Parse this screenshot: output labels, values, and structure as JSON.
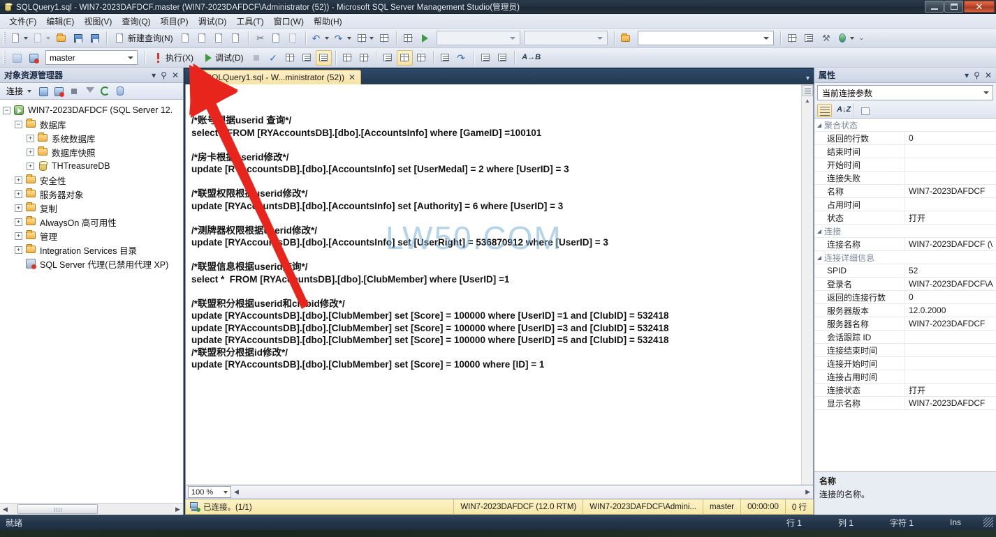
{
  "window": {
    "title": "SQLQuery1.sql - WIN7-2023DAFDCF.master (WIN7-2023DAFDCF\\Administrator (52)) - Microsoft SQL Server Management Studio(管理员)",
    "minimize_label": "最小化",
    "maximize_label": "最大化",
    "close_label": "✕"
  },
  "menubar": {
    "items": [
      {
        "label": "文件(F)"
      },
      {
        "label": "编辑(E)"
      },
      {
        "label": "视图(V)"
      },
      {
        "label": "查询(Q)"
      },
      {
        "label": "项目(P)"
      },
      {
        "label": "调试(D)"
      },
      {
        "label": "工具(T)"
      },
      {
        "label": "窗口(W)"
      },
      {
        "label": "帮助(H)"
      }
    ]
  },
  "toolbar_main": {
    "new_query_label": "新建查询(N)",
    "search_value": "",
    "filter_value": ""
  },
  "toolbar_sql": {
    "database_value": "master",
    "execute_label": "执行(X)",
    "debug_label": "调试(D)"
  },
  "object_explorer": {
    "title": "对象资源管理器",
    "connect_label": "连接",
    "tree": [
      {
        "label": "WIN7-2023DAFDCF (SQL Server 12.",
        "icon": "server-icon",
        "expander": "−",
        "indent": 0
      },
      {
        "label": "数据库",
        "icon": "folder-icon",
        "expander": "−",
        "indent": 1
      },
      {
        "label": "系统数据库",
        "icon": "folder-icon",
        "expander": "+",
        "indent": 2
      },
      {
        "label": "数据库快照",
        "icon": "folder-icon",
        "expander": "+",
        "indent": 2
      },
      {
        "label": "THTreasureDB",
        "icon": "database-icon",
        "expander": "+",
        "indent": 2
      },
      {
        "label": "安全性",
        "icon": "folder-icon",
        "expander": "+",
        "indent": 1
      },
      {
        "label": "服务器对象",
        "icon": "folder-icon",
        "expander": "+",
        "indent": 1
      },
      {
        "label": "复制",
        "icon": "folder-icon",
        "expander": "+",
        "indent": 1
      },
      {
        "label": "AlwaysOn 高可用性",
        "icon": "folder-icon",
        "expander": "+",
        "indent": 1
      },
      {
        "label": "管理",
        "icon": "folder-icon",
        "expander": "+",
        "indent": 1
      },
      {
        "label": "Integration Services 目录",
        "icon": "folder-icon",
        "expander": "+",
        "indent": 1
      },
      {
        "label": "SQL Server 代理(已禁用代理 XP)",
        "icon": "agent-icon",
        "expander": "",
        "indent": 1
      }
    ]
  },
  "editor": {
    "tab_label": "SQLQuery1.sql - W...ministrator (52))",
    "tab_close": "✕",
    "watermark": "LW50.COM",
    "zoom_value": "100 %",
    "lines": [
      "/*账号根据userid 查询*/",
      "select * FROM [RYAccountsDB].[dbo].[AccountsInfo] where [GameID] =100101",
      "",
      "/*房卡根据userid修改*/",
      "update [RYAccountsDB].[dbo].[AccountsInfo] set [UserMedal] = 2 where [UserID] = 3",
      "",
      "/*联盟权限根据userid修改*/",
      "update [RYAccountsDB].[dbo].[AccountsInfo] set [Authority] = 6 where [UserID] = 3",
      "",
      "/*测牌器权限根据userid修改*/",
      "update [RYAccountsDB].[dbo].[AccountsInfo] set [UserRight] = 536870912 where [UserID] = 3",
      "",
      "/*联盟信息根据userid查询*/",
      "select *  FROM [RYAccountsDB].[dbo].[ClubMember] where [UserID] =1",
      "",
      "/*联盟积分根据userid和clubid修改*/",
      "update [RYAccountsDB].[dbo].[ClubMember] set [Score] = 100000 where [UserID] =1 and [ClubID] = 532418",
      "update [RYAccountsDB].[dbo].[ClubMember] set [Score] = 100000 where [UserID] =3 and [ClubID] = 532418",
      "update [RYAccountsDB].[dbo].[ClubMember] set [Score] = 100000 where [UserID] =5 and [ClubID] = 532418",
      "/*联盟积分根据id修改*/",
      "update [RYAccountsDB].[dbo].[ClubMember] set [Score] = 10000 where [ID] = 1"
    ]
  },
  "doc_status": {
    "connected": "已连接。(1/1)",
    "server": "WIN7-2023DAFDCF (12.0 RTM)",
    "user": "WIN7-2023DAFDCF\\Admini...",
    "database": "master",
    "elapsed": "00:00:00",
    "rows": "0 行"
  },
  "properties": {
    "title": "属性",
    "selector_value": "当前连接参数",
    "rows": [
      {
        "type": "category",
        "name": "聚合状态",
        "value": ""
      },
      {
        "type": "prop",
        "name": "返回的行数",
        "value": "0"
      },
      {
        "type": "prop",
        "name": "结束时间",
        "value": ""
      },
      {
        "type": "prop",
        "name": "开始时间",
        "value": ""
      },
      {
        "type": "prop",
        "name": "连接失败",
        "value": ""
      },
      {
        "type": "prop",
        "name": "名称",
        "value": "WIN7-2023DAFDCF"
      },
      {
        "type": "prop",
        "name": "占用时间",
        "value": ""
      },
      {
        "type": "prop",
        "name": "状态",
        "value": "打开"
      },
      {
        "type": "category",
        "name": "连接",
        "value": ""
      },
      {
        "type": "prop",
        "name": "连接名称",
        "value": "WIN7-2023DAFDCF (\\"
      },
      {
        "type": "category",
        "name": "连接详细信息",
        "value": ""
      },
      {
        "type": "prop",
        "name": "SPID",
        "value": "52"
      },
      {
        "type": "prop",
        "name": "登录名",
        "value": "WIN7-2023DAFDCF\\A"
      },
      {
        "type": "prop",
        "name": "返回的连接行数",
        "value": "0"
      },
      {
        "type": "prop",
        "name": "服务器版本",
        "value": "12.0.2000"
      },
      {
        "type": "prop",
        "name": "服务器名称",
        "value": "WIN7-2023DAFDCF"
      },
      {
        "type": "prop",
        "name": "会话跟踪 ID",
        "value": ""
      },
      {
        "type": "prop",
        "name": "连接结束时间",
        "value": ""
      },
      {
        "type": "prop",
        "name": "连接开始时间",
        "value": ""
      },
      {
        "type": "prop",
        "name": "连接占用时间",
        "value": ""
      },
      {
        "type": "prop",
        "name": "连接状态",
        "value": "打开"
      },
      {
        "type": "prop",
        "name": "显示名称",
        "value": "WIN7-2023DAFDCF"
      }
    ],
    "description_title": "名称",
    "description_text": "连接的名称。"
  },
  "statusbar": {
    "ready": "就绪",
    "row": "行 1",
    "col": "列 1",
    "char": "字符 1",
    "insert_mode": "Ins"
  },
  "colors": {
    "accent_tab": "#f6e3a4",
    "status_yellow": "#f6e8a8",
    "annotation_red": "#e8251c",
    "titlebar": "#223140"
  }
}
